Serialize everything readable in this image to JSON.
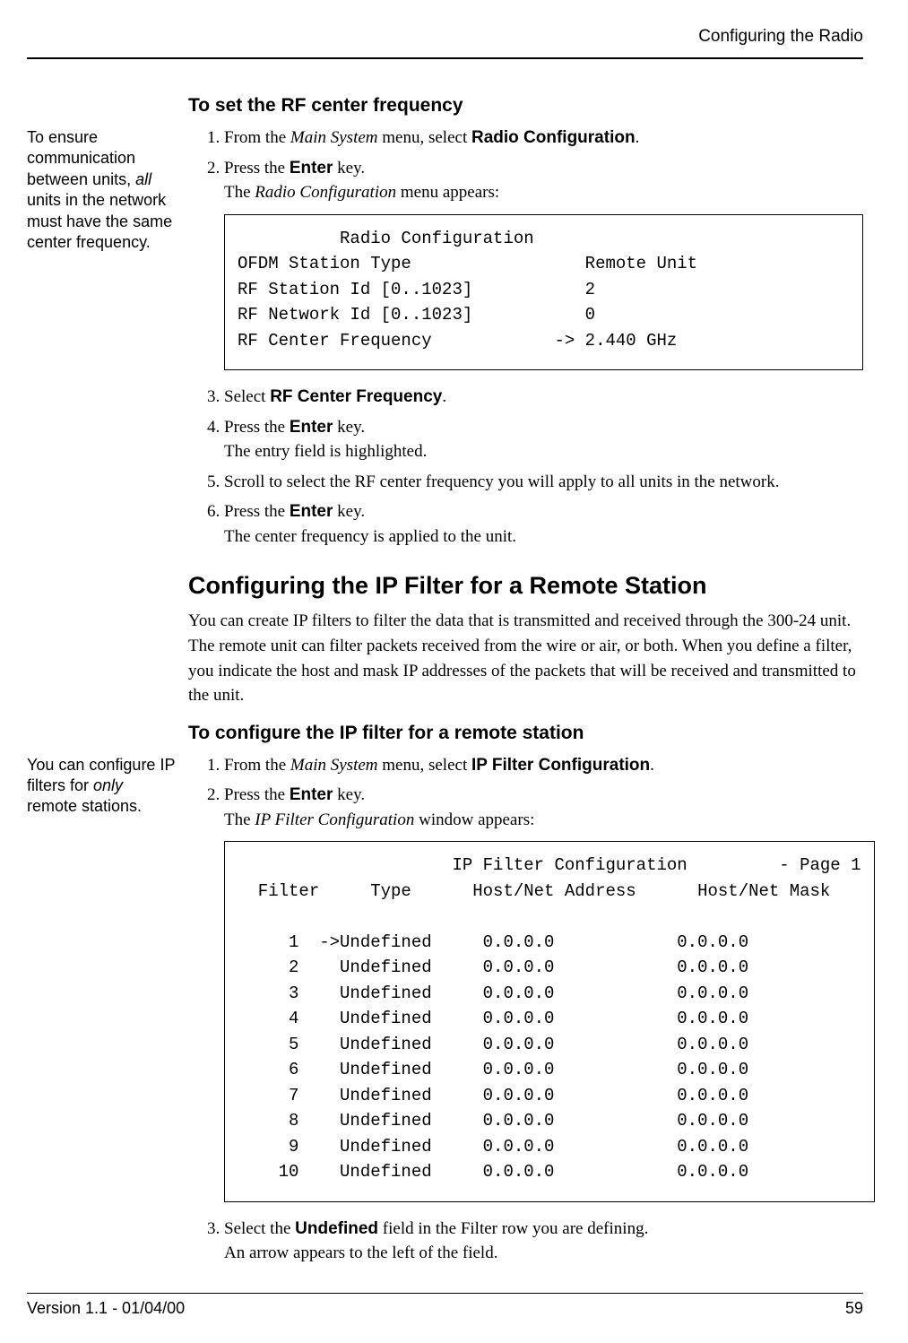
{
  "header": {
    "running_title": "Configuring the Radio"
  },
  "section1": {
    "heading": "To set the RF center frequency",
    "margin_note_pre": "To ensure communication between units, ",
    "margin_note_ital": "all",
    "margin_note_post": " units in the network must have the same center frequency.",
    "step1_pre": "From the ",
    "step1_ital": "Main System",
    "step1_mid": " menu, select ",
    "step1_bold": "Radio Configuration",
    "step1_post": ".",
    "step2_pre": "Press the ",
    "step2_bold": "Enter",
    "step2_mid": " key.",
    "step2_line2_pre": "The ",
    "step2_line2_ital": "Radio Configuration",
    "step2_line2_post": " menu appears:",
    "terminal": "          Radio Configuration\nOFDM Station Type                 Remote Unit\nRF Station Id [0..1023]           2\nRF Network Id [0..1023]           0\nRF Center Frequency            -> 2.440 GHz",
    "step3_pre": "Select ",
    "step3_bold": "RF Center Frequency",
    "step3_post": ".",
    "step4_pre": "Press the ",
    "step4_bold": "Enter",
    "step4_mid": " key.",
    "step4_line2": "The entry field is highlighted.",
    "step5": "Scroll to select the RF center frequency you will apply to all units in the network.",
    "step6_pre": "Press the ",
    "step6_bold": "Enter",
    "step6_mid": " key.",
    "step6_line2": "The center frequency is applied to the unit."
  },
  "section2": {
    "heading": "Configuring the IP Filter for a Remote Station",
    "intro": "You can create IP filters to filter the data that is transmitted and received through the 300-24 unit. The remote unit can filter packets received from the wire or air, or both. When you define a filter, you indicate the host and mask IP addresses of the packets that will be received and transmitted to the unit.",
    "subheading": "To configure the IP filter for a remote station",
    "margin_note_pre": "You can configure IP filters for ",
    "margin_note_ital": "only",
    "margin_note_post": " remote stations.",
    "step1_pre": "From the ",
    "step1_ital": "Main System",
    "step1_mid": " menu, select ",
    "step1_bold": "IP Filter Configuration",
    "step1_post": ".",
    "step2_pre": "Press the ",
    "step2_bold": "Enter",
    "step2_mid": " key.",
    "step2_line2_pre": "The ",
    "step2_line2_ital": "IP Filter Configuration",
    "step2_line2_post": " window appears:",
    "terminal": "                     IP Filter Configuration         - Page 1\n  Filter     Type      Host/Net Address      Host/Net Mask\n\n     1  ->Undefined     0.0.0.0            0.0.0.0\n     2    Undefined     0.0.0.0            0.0.0.0\n     3    Undefined     0.0.0.0            0.0.0.0\n     4    Undefined     0.0.0.0            0.0.0.0\n     5    Undefined     0.0.0.0            0.0.0.0\n     6    Undefined     0.0.0.0            0.0.0.0\n     7    Undefined     0.0.0.0            0.0.0.0\n     8    Undefined     0.0.0.0            0.0.0.0\n     9    Undefined     0.0.0.0            0.0.0.0\n    10    Undefined     0.0.0.0            0.0.0.0",
    "step3_pre": "Select the ",
    "step3_bold": "Undefined",
    "step3_post": " field in the Filter row you are defining.",
    "step3_line2": "An arrow appears to the left of the field."
  },
  "footer": {
    "version": "Version 1.1 - 01/04/00",
    "page": "59"
  }
}
